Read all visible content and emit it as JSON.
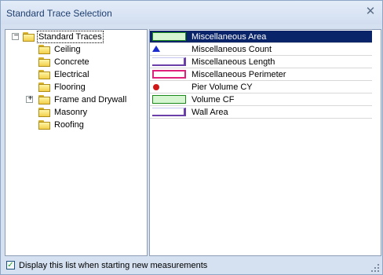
{
  "window": {
    "title": "Standard Trace Selection",
    "close_icon": "close-icon"
  },
  "tree": {
    "root": {
      "label": "Standard Traces",
      "expander": "−",
      "expanded": true
    },
    "children": [
      {
        "label": "Ceiling",
        "expander": ""
      },
      {
        "label": "Concrete",
        "expander": ""
      },
      {
        "label": "Electrical",
        "expander": ""
      },
      {
        "label": "Flooring",
        "expander": ""
      },
      {
        "label": "Frame and Drywall",
        "expander": "+"
      },
      {
        "label": "Masonry",
        "expander": ""
      },
      {
        "label": "Roofing",
        "expander": ""
      }
    ]
  },
  "traces": [
    {
      "label": "Miscellaneous Area",
      "icon": "area-swatch-icon",
      "selected": true
    },
    {
      "label": "Miscellaneous Count",
      "icon": "count-triangle-icon",
      "selected": false
    },
    {
      "label": "Miscellaneous Length",
      "icon": "length-line-icon",
      "selected": false
    },
    {
      "label": "Miscellaneous Perimeter",
      "icon": "perimeter-box-icon",
      "selected": false
    },
    {
      "label": "Pier Volume CY",
      "icon": "volume-dot-icon",
      "selected": false
    },
    {
      "label": "Volume CF",
      "icon": "volume-swatch-icon",
      "selected": false
    },
    {
      "label": "Wall Area",
      "icon": "wall-line-icon",
      "selected": false
    }
  ],
  "colors": {
    "selection": "#0a246a",
    "area_fill": "#d6f6d2",
    "area_border": "#1c8a1a",
    "length_line": "#6a3fa8",
    "perimeter_border": "#e0217c",
    "count_marker": "#1a2bd0",
    "dot_marker": "#d01818"
  },
  "footer": {
    "checkbox_label": "Display this list when starting new measurements",
    "checked": true,
    "check_mark": "✓"
  }
}
